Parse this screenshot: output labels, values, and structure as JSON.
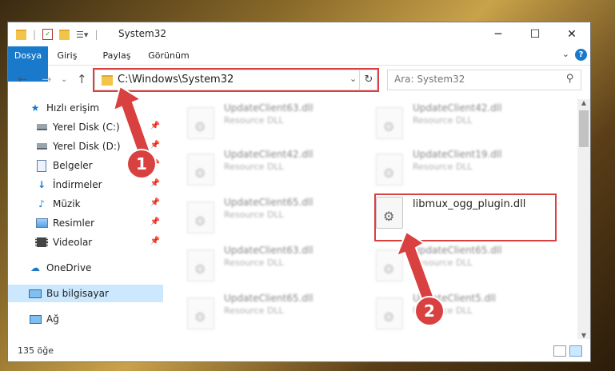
{
  "window": {
    "title": "System32"
  },
  "ribbon": {
    "tabs": [
      "Dosya",
      "Giriş",
      "Paylaş",
      "Görünüm"
    ]
  },
  "address": {
    "path": "C:\\Windows\\System32"
  },
  "search": {
    "placeholder": "Ara: System32"
  },
  "sidebar": {
    "items": [
      {
        "label": "Hızlı erişim",
        "icon": "star-icon"
      },
      {
        "label": "Yerel Disk (C:)",
        "icon": "drive-icon",
        "pinned": true
      },
      {
        "label": "Yerel Disk (D:)",
        "icon": "drive-icon",
        "pinned": true
      },
      {
        "label": "Belgeler",
        "icon": "document-icon",
        "pinned": true
      },
      {
        "label": "İndirmeler",
        "icon": "download-icon",
        "pinned": true
      },
      {
        "label": "Müzik",
        "icon": "music-icon",
        "pinned": true
      },
      {
        "label": "Resimler",
        "icon": "pictures-icon",
        "pinned": true
      },
      {
        "label": "Videolar",
        "icon": "video-icon",
        "pinned": true
      },
      {
        "label": "OneDrive",
        "icon": "cloud-icon"
      },
      {
        "label": "Bu bilgisayar",
        "icon": "computer-icon",
        "selected": true
      },
      {
        "label": "Ağ",
        "icon": "network-icon"
      }
    ]
  },
  "files": [
    {
      "name": "UpdateClient63.dll",
      "type": "Resource DLL"
    },
    {
      "name": "UpdateClient42.dll",
      "type": "Resource DLL"
    },
    {
      "name": "UpdateClient42.dll",
      "type": "Resource DLL"
    },
    {
      "name": "UpdateClient19.dll",
      "type": "Resource DLL"
    },
    {
      "name": "UpdateClient65.dll",
      "type": "Resource DLL"
    },
    {
      "name": "libmux_ogg_plugin.dll",
      "type": ""
    },
    {
      "name": "UpdateClient63.dll",
      "type": "Resource DLL"
    },
    {
      "name": "UpdateClient65.dll",
      "type": "Resource DLL"
    },
    {
      "name": "UpdateClient65.dll",
      "type": "Resource DLL"
    },
    {
      "name": "UpdateClient5.dll",
      "type": "Resource DLL"
    }
  ],
  "status": {
    "count": "135 öğe"
  },
  "annotations": {
    "first": "1",
    "second": "2"
  },
  "colors": {
    "accent": "#1979ca",
    "highlight": "#d94040"
  }
}
